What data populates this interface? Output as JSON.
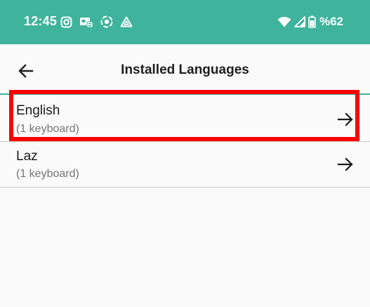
{
  "status_bar": {
    "time": "12:45",
    "battery_text": "%62",
    "background_color": "#3fb39c",
    "left_icons": [
      "instagram-icon",
      "sim-card-icon",
      "record-icon",
      "drive-icon"
    ],
    "right_icons": [
      "wifi-icon",
      "signal-icon",
      "battery-icon"
    ]
  },
  "toolbar": {
    "title": "Installed Languages",
    "back_icon": "back-arrow-icon"
  },
  "languages": [
    {
      "name": "English",
      "subtitle": "(1 keyboard)",
      "icon": "arrow-right-icon",
      "highlighted": true
    },
    {
      "name": "Laz",
      "subtitle": "(1 keyboard)",
      "icon": "arrow-right-icon",
      "highlighted": false
    }
  ],
  "colors": {
    "accent": "#3fb39c",
    "highlight": "#ff0000"
  }
}
